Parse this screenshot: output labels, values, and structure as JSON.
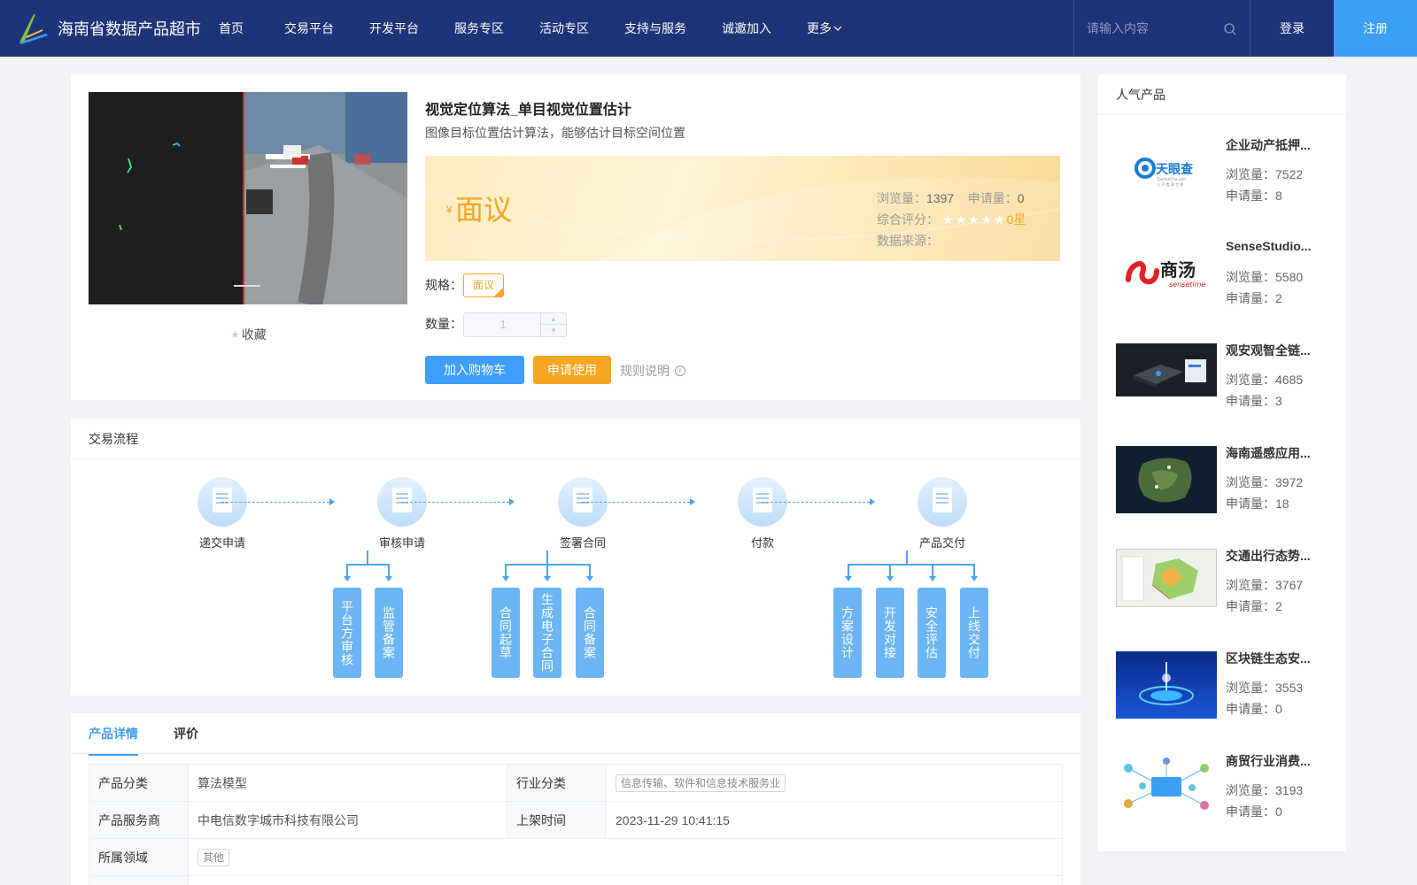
{
  "header": {
    "brand": "海南省数据产品超市",
    "nav": [
      "首页",
      "交易平台",
      "开发平台",
      "服务专区",
      "活动专区",
      "支持与服务",
      "诚邀加入",
      "更多"
    ],
    "search_placeholder": "请输入内容",
    "login": "登录",
    "register": "注册"
  },
  "product": {
    "title": "视觉定位算法_单目视觉位置估计",
    "subtitle": "图像目标位置估计算法，能够估计目标空间位置",
    "favorite": "收藏",
    "currency": "¥",
    "price": "面议",
    "views_label": "浏览量：",
    "views": "1397",
    "applies_label": "申请量：",
    "applies": "0",
    "rating_label": "综合评分：",
    "stars": "★★★★★",
    "rating": "0星",
    "rating_value": 0,
    "source_label": "数据来源：",
    "spec_label": "规格：",
    "spec": "面议",
    "qty_label": "数量：",
    "qty": "1",
    "add_cart": "加入购物车",
    "apply": "申请使用",
    "rules": "规则说明"
  },
  "flow": {
    "title": "交易流程",
    "steps": [
      "递交申请",
      "审核申请",
      "签署合同",
      "付款",
      "产品交付"
    ],
    "review_sub": [
      "平台方审核",
      "监管备案"
    ],
    "contract_sub": [
      "合同起草",
      "生成电子合同",
      "合同备案"
    ],
    "delivery_sub": [
      "方案设计",
      "开发对接",
      "安全评估",
      "上线交付"
    ]
  },
  "detail": {
    "tabs": [
      "产品详情",
      "评价"
    ],
    "rows": [
      {
        "k1": "产品分类",
        "v1": "算法模型",
        "k2": "行业分类",
        "v2": "信息传输、软件和信息技术服务业"
      },
      {
        "k1": "产品服务商",
        "v1": "中电信数字城市科技有限公司",
        "k2": "上架时间",
        "v2": "2023-11-29 10:41:15"
      },
      {
        "k1": "所属领域",
        "v1": "其他"
      }
    ]
  },
  "sidebar": {
    "title": "人气产品",
    "items": [
      {
        "title": "企业动产抵押...",
        "views": "浏览量：7522",
        "applies": "申请量：8",
        "logo_text": "天眼查",
        "logo_sub": "TianYanCha.com",
        "logo_sub2": "公 平 看 清 世 界"
      },
      {
        "title": "SenseStudio...",
        "views": "浏览量：5580",
        "applies": "申请量：2",
        "logo_text": "商汤",
        "logo_sub": "sensetime"
      },
      {
        "title": "观安观智全链...",
        "views": "浏览量：4685",
        "applies": "申请量：3"
      },
      {
        "title": "海南遥感应用...",
        "views": "浏览量：3972",
        "applies": "申请量：18"
      },
      {
        "title": "交通出行态势...",
        "views": "浏览量：3767",
        "applies": "申请量：2"
      },
      {
        "title": "区块链生态安...",
        "views": "浏览量：3553",
        "applies": "申请量：0"
      },
      {
        "title": "商贸行业消费...",
        "views": "浏览量：3193",
        "applies": "申请量：0"
      }
    ]
  }
}
